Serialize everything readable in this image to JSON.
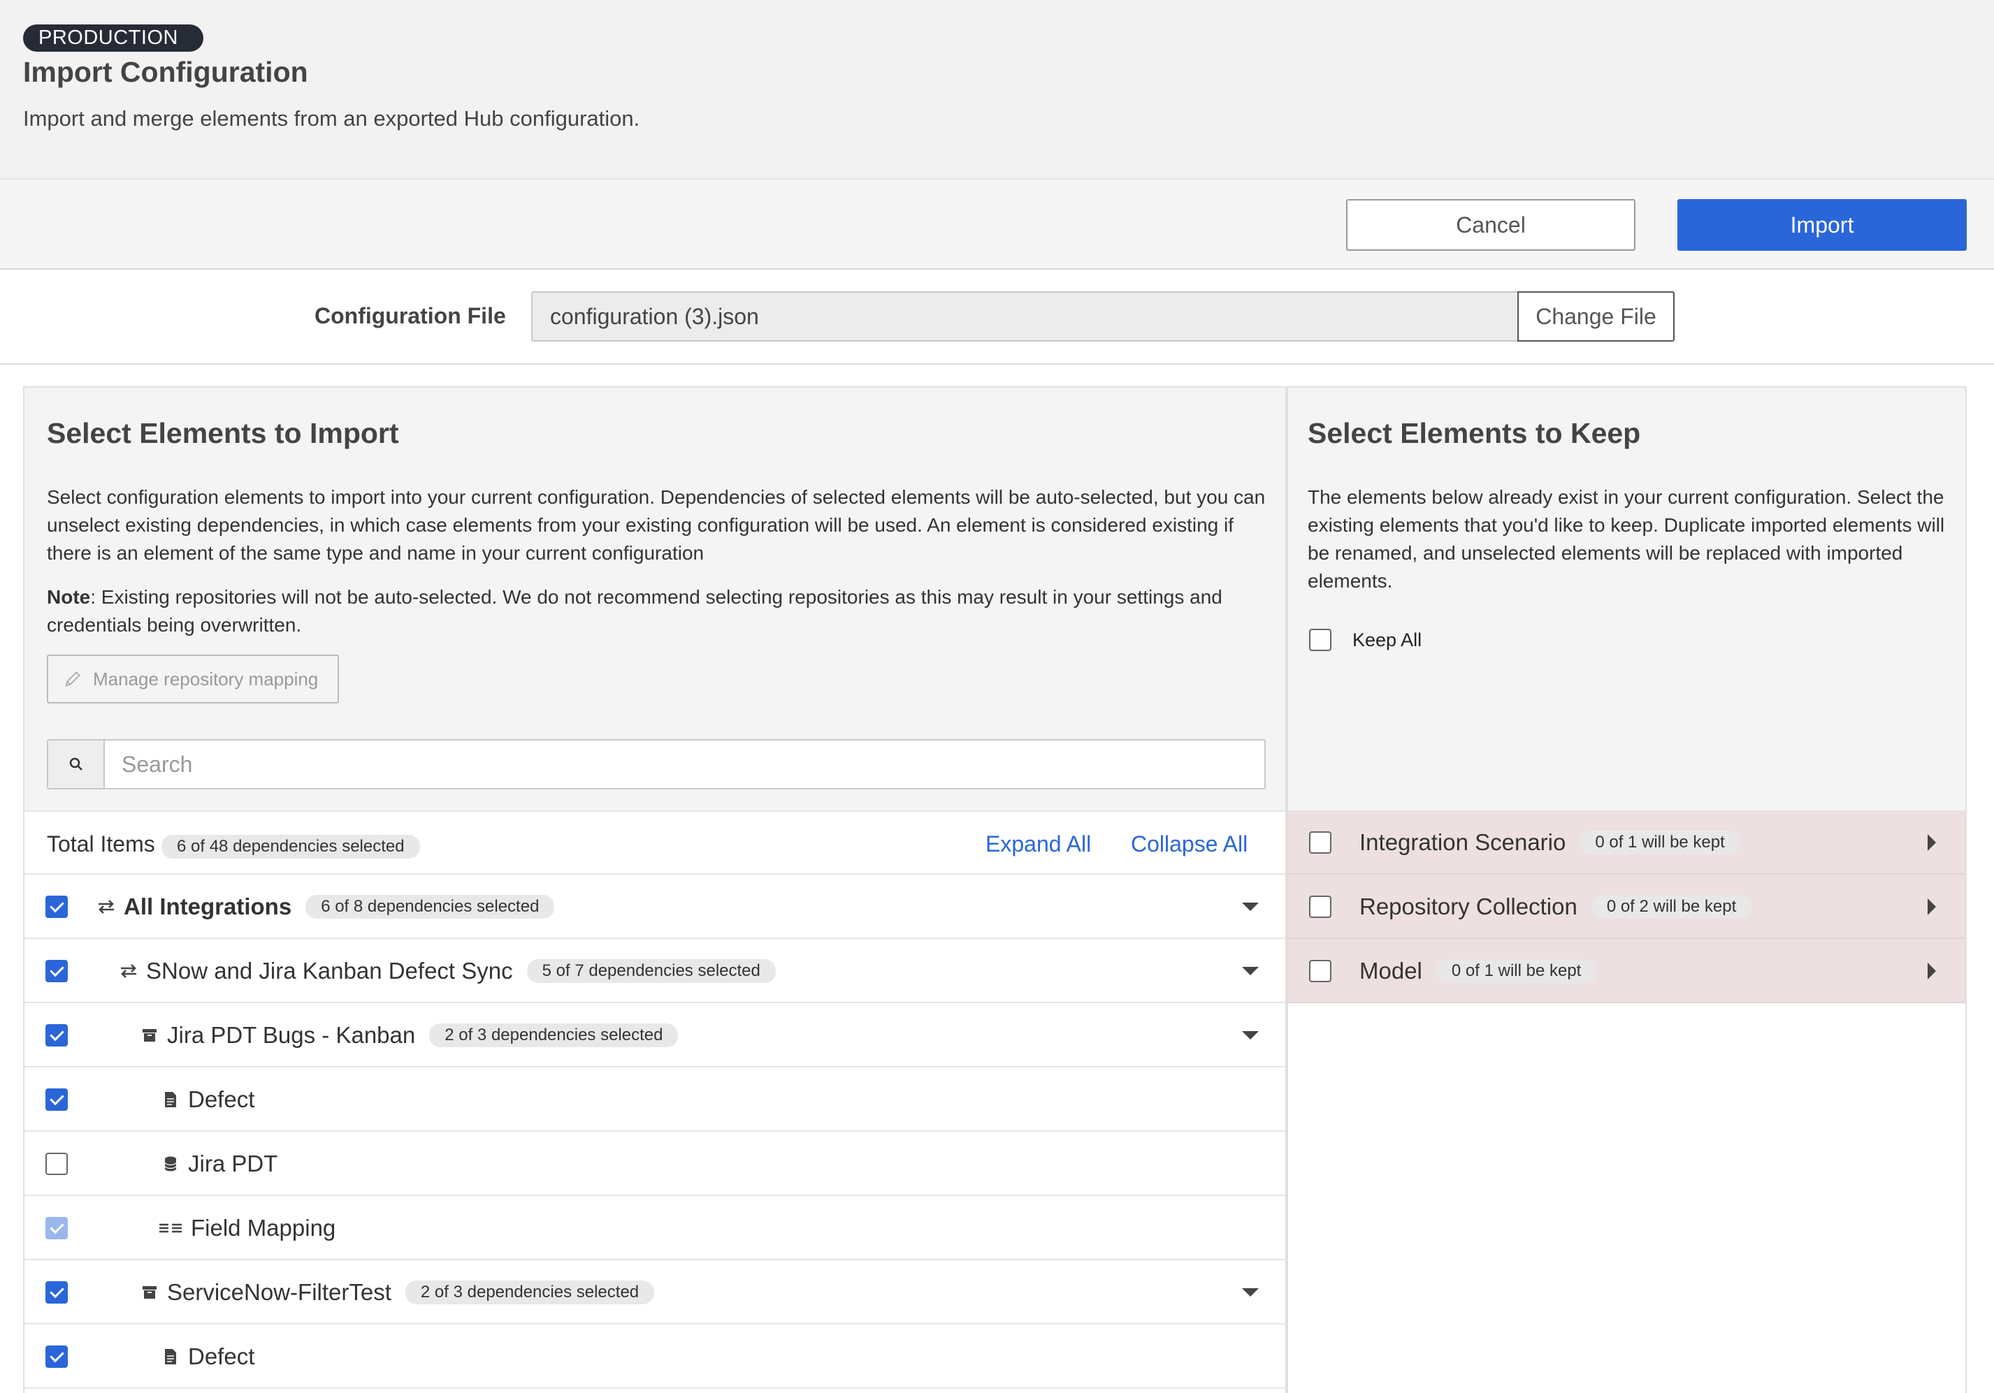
{
  "header": {
    "env_badge": "PRODUCTION",
    "title": "Import Configuration",
    "subtitle": "Import and merge elements from an exported Hub configuration."
  },
  "actions": {
    "cancel_label": "Cancel",
    "import_label": "Import"
  },
  "config_file": {
    "label": "Configuration File",
    "value": "configuration (3).json",
    "change_label": "Change File"
  },
  "import_panel": {
    "title": "Select Elements to Import",
    "description_1": "Select configuration elements to import into your current configuration. Dependencies of selected elements will be auto-selected, but you can unselect existing dependencies, in which case elements from your existing configuration will be used. An element is considered existing if there is an element of the same type and name in your current configuration",
    "note_label": "Note",
    "note_text": ": Existing repositories will not be auto-selected. We do not recommend selecting repositories as this may result in your settings and credentials being overwritten.",
    "manage_mapping_label": "Manage repository mapping",
    "search_placeholder": "Search",
    "total_label": "Total Items",
    "total_badge": "6 of 48 dependencies selected",
    "expand_all": "Expand All",
    "collapse_all": "Collapse All",
    "rows": [
      {
        "label": "All Integrations",
        "badge": "6 of 8 dependencies selected",
        "checked": true,
        "icon": "integration-icon"
      },
      {
        "label": "SNow and Jira Kanban Defect Sync",
        "badge": "5 of 7 dependencies selected",
        "checked": true,
        "icon": "integration-icon"
      },
      {
        "label": "Jira PDT Bugs - Kanban",
        "badge": "2 of 3 dependencies selected",
        "checked": true,
        "icon": "collection-icon"
      },
      {
        "label": "Defect",
        "checked": true,
        "icon": "document-icon"
      },
      {
        "label": "Jira PDT",
        "checked": false,
        "icon": "database-icon"
      },
      {
        "label": "Field Mapping",
        "checked": true,
        "disabled": true,
        "icon": "mapping-icon"
      },
      {
        "label": "ServiceNow-FilterTest",
        "badge": "2 of 3 dependencies selected",
        "checked": true,
        "icon": "collection-icon"
      },
      {
        "label": "Defect",
        "checked": true,
        "icon": "document-icon"
      }
    ]
  },
  "keep_panel": {
    "title": "Select Elements to Keep",
    "description": "The elements below already exist in your current configuration. Select the existing elements that you'd like to keep. Duplicate imported elements will be renamed, and unselected elements will be replaced with imported elements.",
    "keep_all_label": "Keep All",
    "rows": [
      {
        "label": "Integration Scenario",
        "badge": "0 of 1 will be kept"
      },
      {
        "label": "Repository Collection",
        "badge": "0 of 2 will be kept"
      },
      {
        "label": "Model",
        "badge": "0 of 1 will be kept"
      }
    ]
  },
  "colors": {
    "accent": "#2a66d9",
    "badge_dark": "#262b36",
    "keep_row_bg": "#ede0e0"
  }
}
